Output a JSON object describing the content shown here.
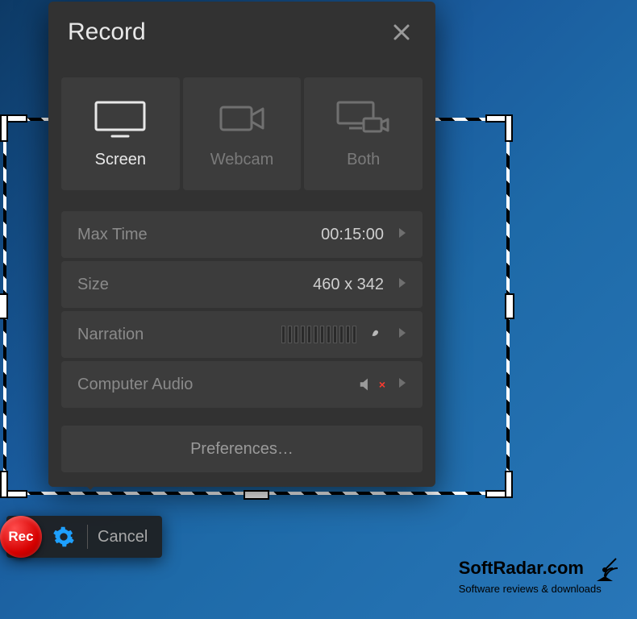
{
  "panel": {
    "title": "Record",
    "sources": {
      "screen": "Screen",
      "webcam": "Webcam",
      "both": "Both"
    },
    "rows": {
      "max_time": {
        "label": "Max Time",
        "value": "00:15:00"
      },
      "size": {
        "label": "Size",
        "value": "460 x 342"
      },
      "narration": {
        "label": "Narration"
      },
      "audio": {
        "label": "Computer Audio"
      }
    },
    "preferences": "Preferences…"
  },
  "toolbar": {
    "rec": "Rec",
    "cancel": "Cancel"
  },
  "watermark": {
    "name": "SoftRadar.com",
    "tagline": "Software reviews & downloads"
  }
}
